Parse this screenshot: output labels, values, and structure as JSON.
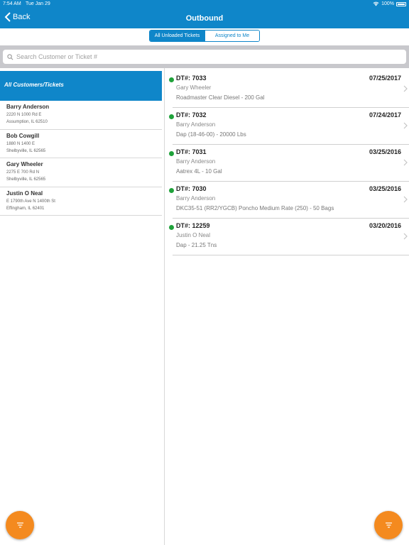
{
  "status_bar": {
    "time": "7:54 AM",
    "day": "Tue Jan 29",
    "battery": "100%"
  },
  "nav": {
    "back_label": "Back",
    "title": "Outbound"
  },
  "segments": [
    "All Unloaded Tickets",
    "Assigned to Me"
  ],
  "search": {
    "placeholder": "Search Customer or Ticket #"
  },
  "sidebar": {
    "all_label": "All Customers/Tickets",
    "customers": [
      {
        "name": "Barry Anderson",
        "address1": "2220 N 1000 Rd E",
        "address2": "Assumption,  IL  62510"
      },
      {
        "name": "Bob Cowgill",
        "address1": "1880 N 1400 E",
        "address2": "Shelbyville,  IL  62565"
      },
      {
        "name": "Gary Wheeler",
        "address1": "2275 E 700 Rd N",
        "address2": "Shelbyville,  IL  62565"
      },
      {
        "name": "Justin O Neal",
        "address1": "E 1790th Ave  N 1400th St",
        "address2": "Effingham,  IL  62401"
      }
    ]
  },
  "tickets": [
    {
      "id": "DT#: 7033",
      "date": "07/25/2017",
      "customer": "Gary Wheeler",
      "product": "Roadmaster Clear Diesel - 200  Gal"
    },
    {
      "id": "DT#: 7032",
      "date": "07/24/2017",
      "customer": "Barry Anderson",
      "product": "Dap (18-46-00) - 20000  Lbs"
    },
    {
      "id": "DT#: 7031",
      "date": "03/25/2016",
      "customer": "Barry Anderson",
      "product": "Aatrex 4L - 10  Gal"
    },
    {
      "id": "DT#: 7030",
      "date": "03/25/2016",
      "customer": "Barry Anderson",
      "product": "DKC35-51 (RR2/YGCB) Poncho Medium Rate (250) - 50  Bags"
    },
    {
      "id": "DT#: 12259",
      "date": "03/20/2016",
      "customer": "Justin O Neal",
      "product": "Dap - 21.25  Tns"
    }
  ],
  "colors": {
    "primary": "#0f86c9",
    "status_dot": "#1fa23a",
    "fab": "#f48a1f"
  },
  "icons": {
    "back": "chevron-left-icon",
    "search": "search-icon",
    "row": "chevron-right-icon",
    "fab": "filter-icon"
  }
}
